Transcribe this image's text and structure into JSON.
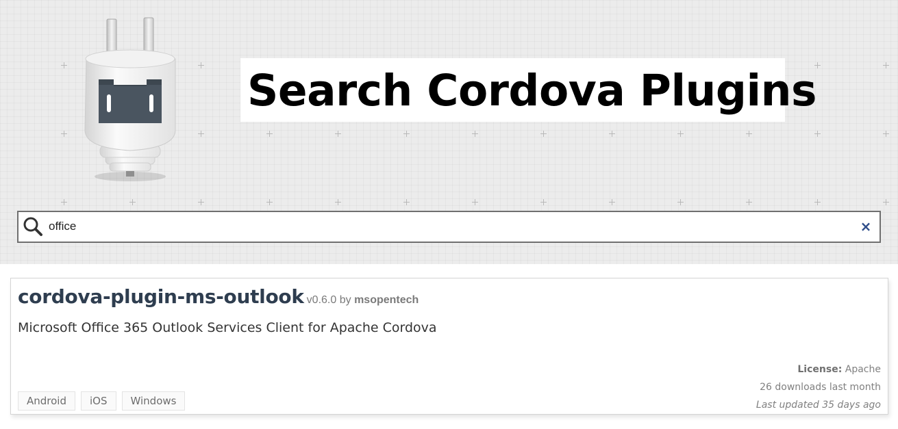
{
  "header": {
    "title": "Search Cordova Plugins",
    "logo_icon": "cordova-plug-robot-icon"
  },
  "search": {
    "value": "office",
    "placeholder": "",
    "icon": "search-icon",
    "clear_label": "×"
  },
  "results": [
    {
      "name": "cordova-plugin-ms-outlook",
      "version": "v0.6.0",
      "by_label": "by",
      "author": "msopentech",
      "description": "Microsoft Office 365 Outlook Services Client for Apache Cordova",
      "platforms": [
        "Android",
        "iOS",
        "Windows"
      ],
      "license_label": "License:",
      "license": "Apache",
      "downloads": "26 downloads last month",
      "updated": "Last updated 35 days ago"
    }
  ],
  "colors": {
    "title_text": "#000000",
    "plugin_name": "#2e3d4f",
    "clear_icon": "#2e4d8a",
    "hero_bg": "#ececec"
  }
}
